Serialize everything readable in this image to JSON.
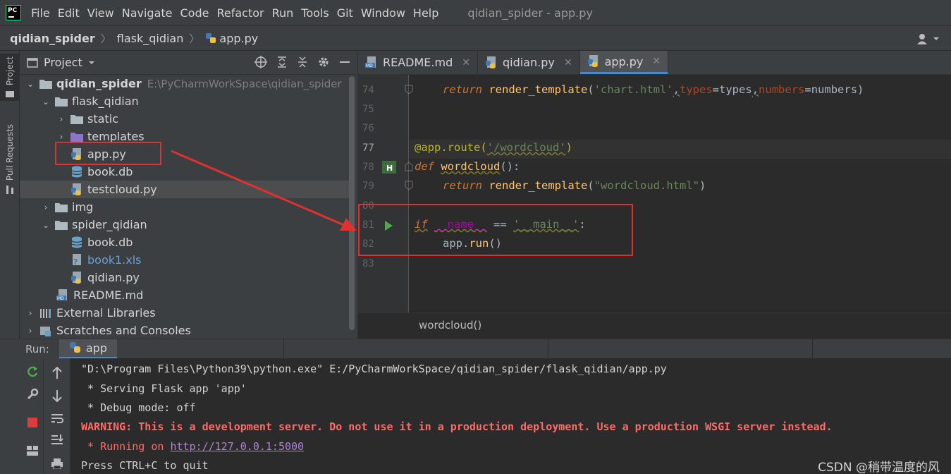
{
  "menubar": {
    "logo_text": "PC",
    "items": [
      "File",
      "Edit",
      "View",
      "Navigate",
      "Code",
      "Refactor",
      "Run",
      "Tools",
      "Git",
      "Window",
      "Help"
    ],
    "window_title": "qidian_spider - app.py"
  },
  "breadcrumb": {
    "items": [
      "qidian_spider",
      "flask_qidian",
      "app.py"
    ]
  },
  "left_strip": {
    "project_label": "Project",
    "pull_label": "Pull Requests"
  },
  "project_panel": {
    "title": "Project",
    "tree": [
      {
        "label": "qidian_spider",
        "path": "E:\\PyCharmWorkSpace\\qidian_spider",
        "icon": "folder-icon"
      },
      {
        "label": "flask_qidian",
        "icon": "folder-icon"
      },
      {
        "label": "static",
        "icon": "folder-icon"
      },
      {
        "label": "templates",
        "icon": "folder-purple-icon"
      },
      {
        "label": "app.py",
        "icon": "python-file-icon"
      },
      {
        "label": "book.db",
        "icon": "database-icon"
      },
      {
        "label": "testcloud.py",
        "icon": "python-file-icon"
      },
      {
        "label": "img",
        "icon": "folder-icon"
      },
      {
        "label": "spider_qidian",
        "icon": "folder-icon"
      },
      {
        "label": "book.db",
        "icon": "database-icon"
      },
      {
        "label": "book1.xls",
        "icon": "unknown-file-icon"
      },
      {
        "label": "qidian.py",
        "icon": "python-file-icon"
      },
      {
        "label": "README.md",
        "icon": "markdown-file-icon"
      },
      {
        "label": "External Libraries",
        "icon": "library-icon"
      },
      {
        "label": "Scratches and Consoles",
        "icon": "scratches-icon"
      }
    ]
  },
  "editor": {
    "tabs": [
      {
        "label": "README.md",
        "icon": "markdown-file-icon"
      },
      {
        "label": "qidian.py",
        "icon": "python-file-icon"
      },
      {
        "label": "app.py",
        "icon": "python-file-icon",
        "active": true
      }
    ],
    "line_numbers": [
      "74",
      "75",
      "76",
      "77",
      "78",
      "79",
      "80",
      "81",
      "82",
      "83"
    ],
    "code": {
      "l74_return": "return",
      "l74_fn": "render_template",
      "l74_str": "'chart.html'",
      "l74_p1": "types",
      "l74_v1": "types",
      "l74_p2": "numbers",
      "l74_v2": "numbers",
      "l77_dec": "@app.route(",
      "l77_str": "'/wordcloud'",
      "l77_close": ")",
      "l78_def": "def",
      "l78_fn": "wordcloud",
      "l78_rest": "():",
      "l79_return": "return",
      "l79_fn": "render_template",
      "l79_str": "\"wordcloud.html\"",
      "l81_if": "if",
      "l81_name": "__name__",
      "l81_eq": " == ",
      "l81_str": "'__main__'",
      "l81_colon": ":",
      "l82_obj": "app.",
      "l82_fn": "run",
      "l82_rest": "()"
    },
    "breadcrumb_function": "wordcloud()"
  },
  "run_panel": {
    "label": "Run:",
    "tab": "app",
    "console": {
      "line1": "\"D:\\Program Files\\Python39\\python.exe\" E:/PyCharmWorkSpace/qidian_spider/flask_qidian/app.py",
      "line2": " * Serving Flask app 'app'",
      "line3": " * Debug mode: off",
      "line4": "WARNING: This is a development server. Do not use it in a production deployment. Use a production WSGI server instead.",
      "line5_prefix": " * Running on ",
      "line5_link": "http://127.0.0.1:5000",
      "line6": "Press CTRL+C to quit"
    }
  },
  "watermark": "CSDN @稍带温度的风",
  "colors": {
    "annotation": "#e03030",
    "accent": "#4a88c7"
  }
}
